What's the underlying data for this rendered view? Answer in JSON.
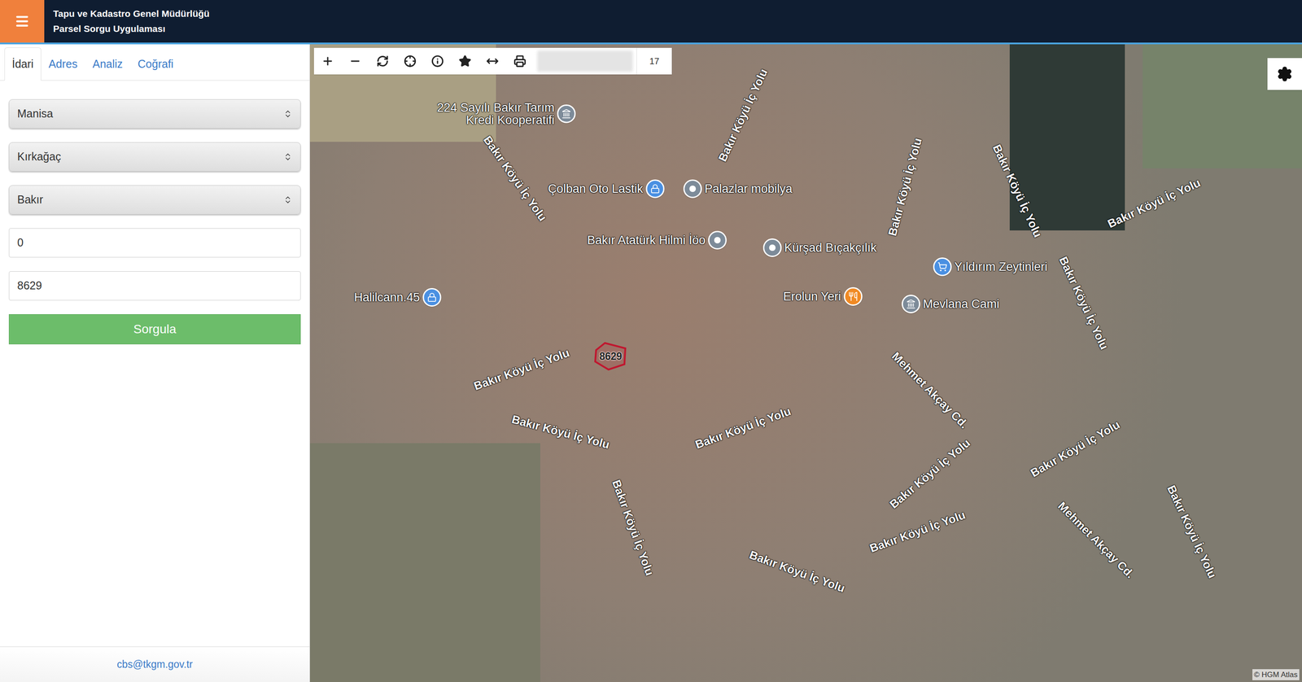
{
  "header": {
    "title_lines": [
      "Tapu ve Kadastro Genel Müdürlüğü",
      "Parsel Sorgu Uygulaması"
    ]
  },
  "tabs": [
    {
      "label": "İdari",
      "selected": true
    },
    {
      "label": "Adres",
      "selected": false
    },
    {
      "label": "Analiz",
      "selected": false
    },
    {
      "label": "Coğrafi",
      "selected": false
    }
  ],
  "form": {
    "fields": [
      {
        "kind": "select",
        "value": "Manisa"
      },
      {
        "kind": "select",
        "value": "Kırkağaç"
      },
      {
        "kind": "select",
        "value": "Bakır"
      },
      {
        "kind": "input",
        "value": "0"
      },
      {
        "kind": "input",
        "value": "8629"
      }
    ],
    "button": "Sorgula"
  },
  "footer": {
    "email": "cbs@tkgm.gov.tr"
  },
  "map": {
    "toolbar": {
      "zoom": "17"
    },
    "pois": [
      {
        "lines": [
          "224 Sayılı Bakır Tarım",
          "Kredi Kooperatifi"
        ],
        "kind": "landmark",
        "color": "#7d8b99"
      },
      {
        "lines": [
          "Çolban Oto Lastik"
        ],
        "kind": "lock",
        "color": "#4a90e2"
      },
      {
        "lines": [
          "Palazlar mobilya"
        ],
        "kind": "dot",
        "color": "#7d8b99"
      },
      {
        "lines": [
          "Bakır Atatürk Hilmi İöo"
        ],
        "kind": "dot",
        "color": "#7d8b99"
      },
      {
        "lines": [
          "Kürşad Bıçakçılık"
        ],
        "kind": "dot",
        "color": "#7d8b99"
      },
      {
        "lines": [
          "Yıldırım Zeytinleri"
        ],
        "kind": "cart",
        "color": "#4a90e2"
      },
      {
        "lines": [
          "Erolun Yeri"
        ],
        "kind": "food",
        "color": "#f08a24"
      },
      {
        "lines": [
          "Mevlana Cami"
        ],
        "kind": "landmark",
        "color": "#7d8b99"
      },
      {
        "lines": [
          "Halilcann.45"
        ],
        "kind": "lock",
        "color": "#4a90e2"
      }
    ],
    "roads": [
      "Bakır Köyü İç Yolu",
      "Bakır Köyü İç Yolu",
      "Bakır Köyü İç Yolu",
      "Bakır Köyü İç Yolu",
      "Bakır Köyü İç Yolu",
      "Bakır Köyü İç Yolu",
      "Bakır Köyü İç Yolu",
      "Bakır Köyü İç Yolu",
      "Bakır Köyü İç Yolu",
      "Bakır Köyü İç Yolu",
      "Bakır Köyü İç Yolu",
      "Bakır Köyü İç Yolu",
      "Bakır Köyü İç Yolu",
      "Bakır Köyü İç Yolu",
      "Bakır Köyü İç Yolu",
      "Mehmet Akçay Cd.",
      "Mehmet Akçay Cd."
    ],
    "parcel": {
      "label": "8629"
    },
    "attribution": "© HGM Atlas"
  }
}
